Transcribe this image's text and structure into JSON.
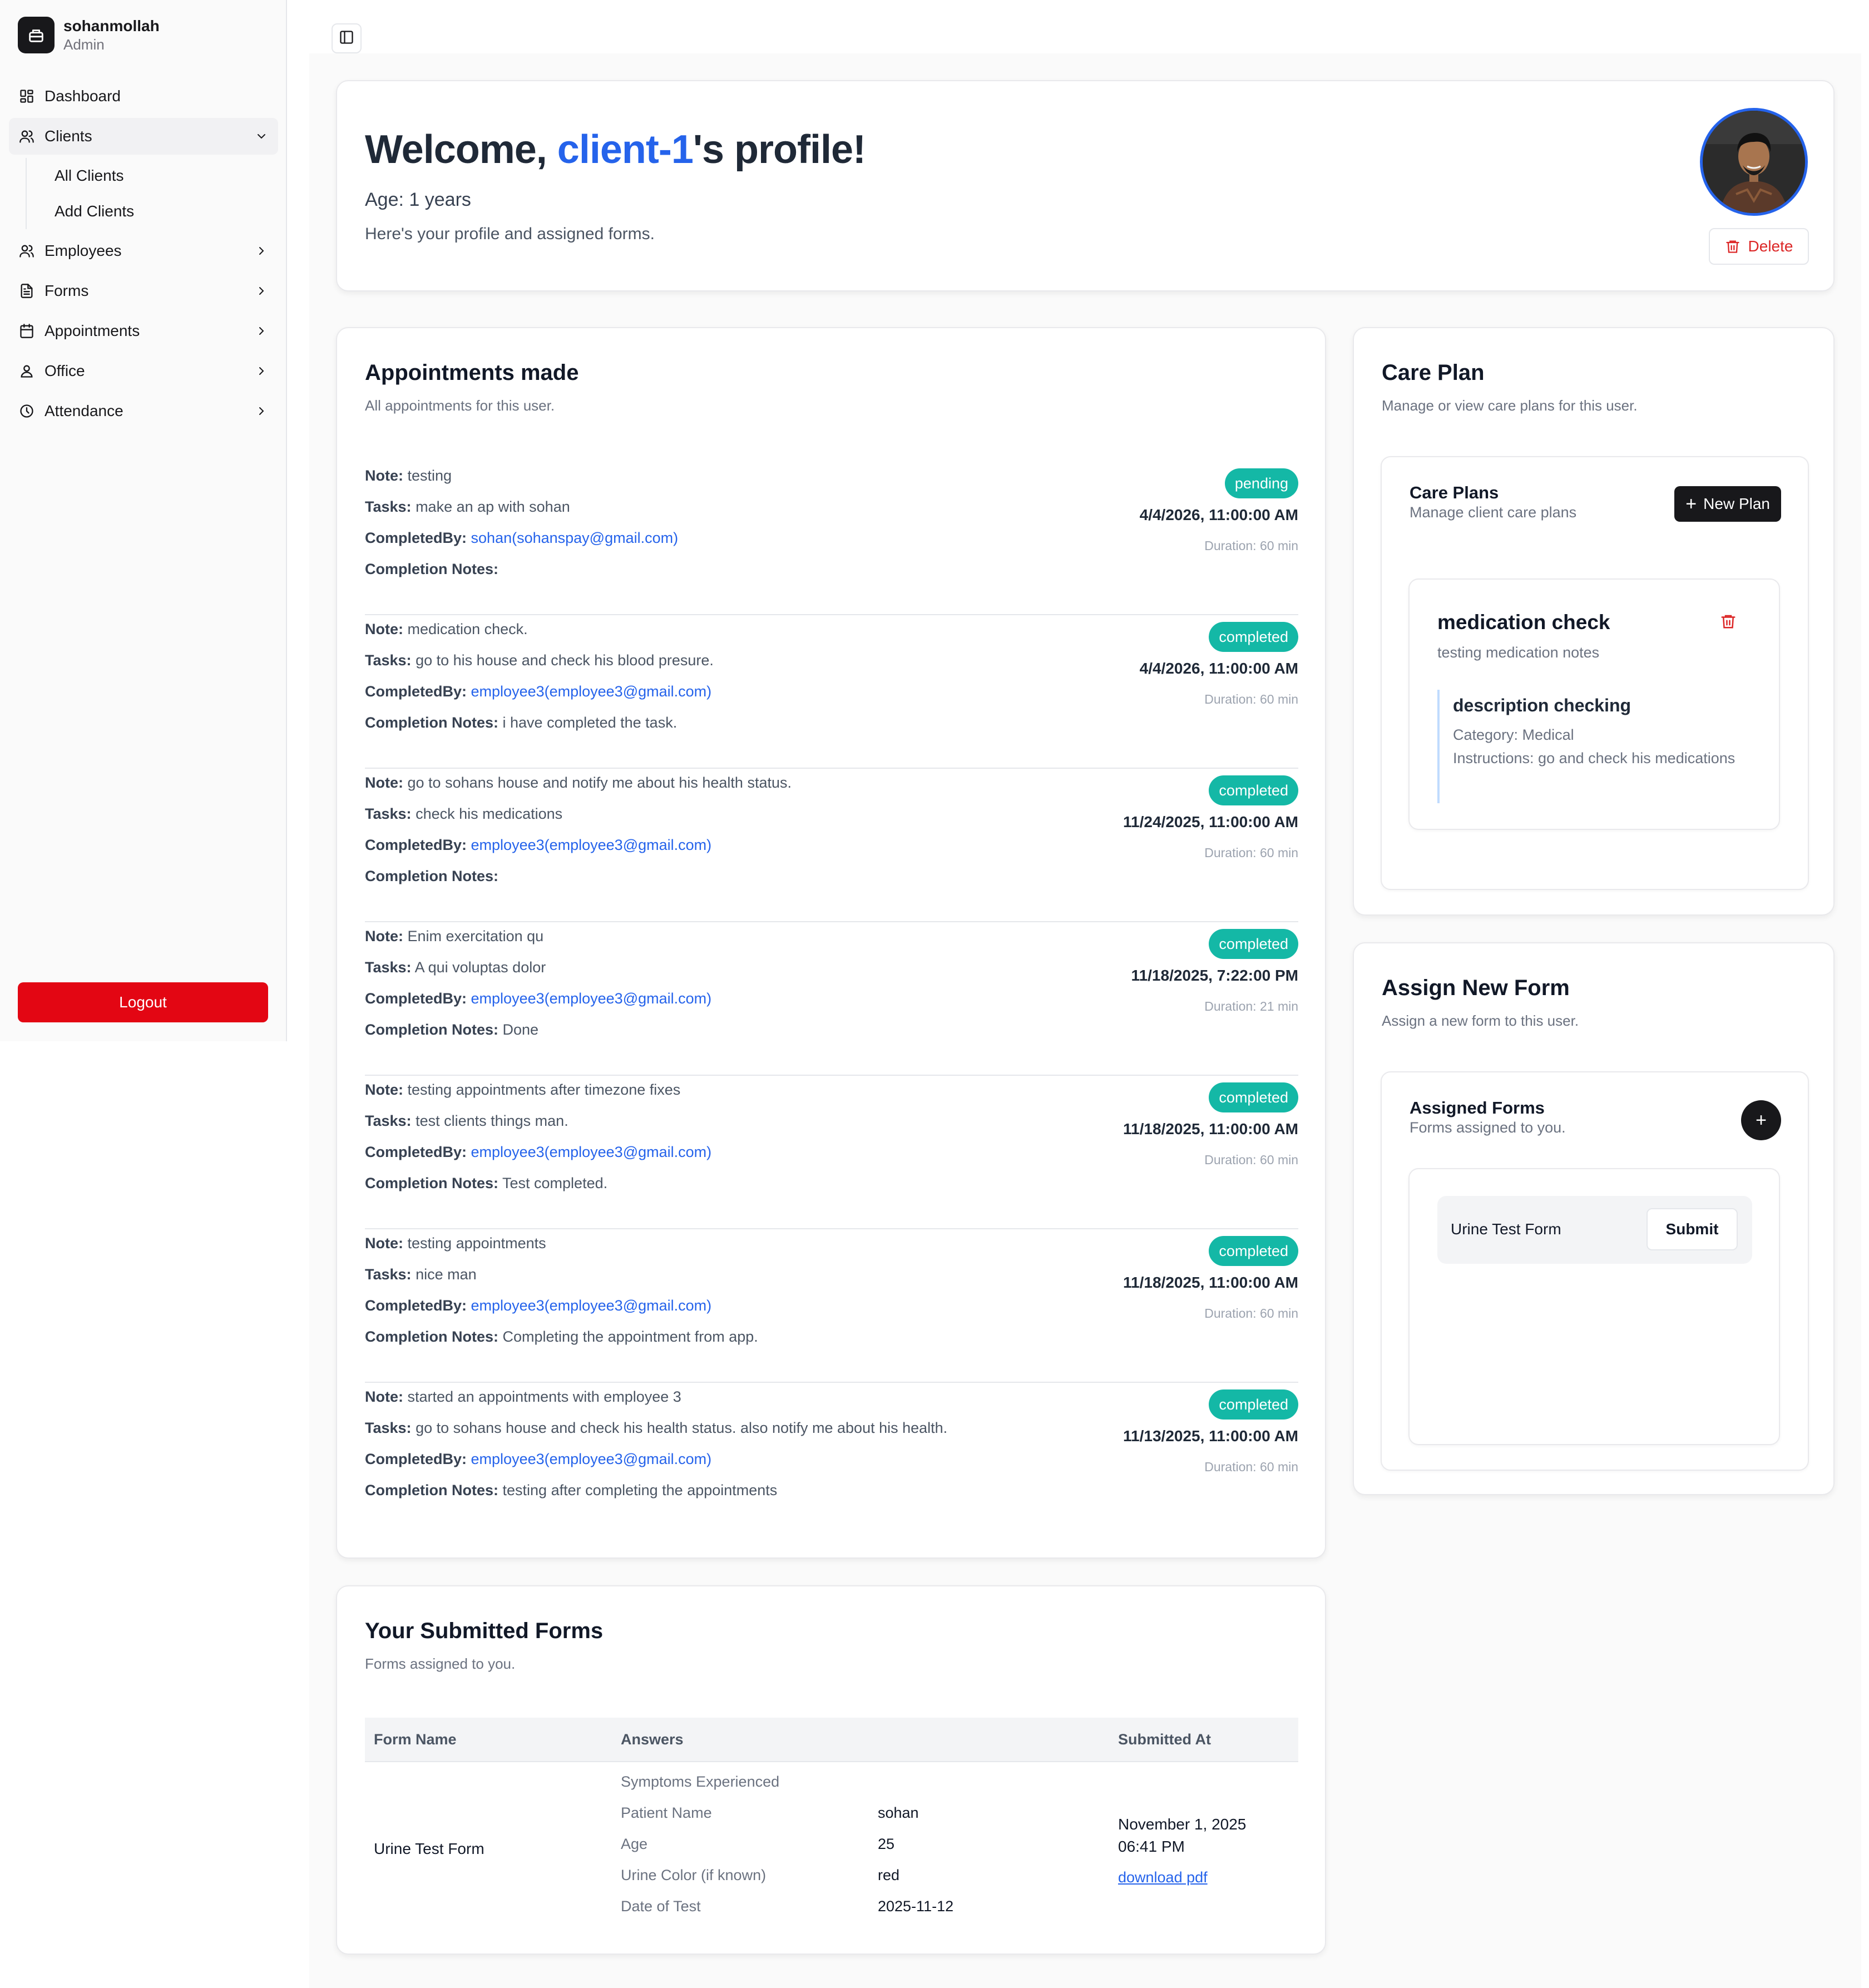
{
  "brand": {
    "name": "sohanmollah",
    "role": "Admin"
  },
  "sidebar": {
    "items": [
      {
        "label": "Dashboard"
      },
      {
        "label": "Clients",
        "children": [
          "All Clients",
          "Add Clients"
        ]
      },
      {
        "label": "Employees"
      },
      {
        "label": "Forms"
      },
      {
        "label": "Appointments"
      },
      {
        "label": "Office"
      },
      {
        "label": "Attendance"
      }
    ],
    "logout_label": "Logout"
  },
  "welcome": {
    "prefix": "Welcome, ",
    "client_name": "client-1",
    "suffix": "'s profile!",
    "age": "Age: 1 years",
    "subtitle": "Here's your profile and assigned forms.",
    "delete_label": "Delete"
  },
  "appointments": {
    "title": "Appointments made",
    "description": "All appointments for this user.",
    "labels": {
      "note": "Note:",
      "tasks": "Tasks:",
      "completed_by": "CompletedBy:",
      "completion_notes": "Completion Notes:"
    },
    "items": [
      {
        "note": "testing",
        "tasks": "make an ap with sohan",
        "completed_by": "sohan(sohanspay@gmail.com)",
        "completion_notes": "",
        "status": "pending",
        "datetime": "4/4/2026, 11:00:00 AM",
        "duration": "Duration: 60 min"
      },
      {
        "note": "medication check.",
        "tasks": "go to his house and check his blood presure.",
        "completed_by": "employee3(employee3@gmail.com)",
        "completion_notes": "i have completed the task.",
        "status": "completed",
        "datetime": "4/4/2026, 11:00:00 AM",
        "duration": "Duration: 60 min"
      },
      {
        "note": "go to sohans house and notify me about his health status.",
        "tasks": "check his medications",
        "completed_by": "employee3(employee3@gmail.com)",
        "completion_notes": "",
        "status": "completed",
        "datetime": "11/24/2025, 11:00:00 AM",
        "duration": "Duration: 60 min"
      },
      {
        "note": "Enim exercitation qu",
        "tasks": "A qui voluptas dolor",
        "completed_by": "employee3(employee3@gmail.com)",
        "completion_notes": "Done",
        "status": "completed",
        "datetime": "11/18/2025, 7:22:00 PM",
        "duration": "Duration: 21 min"
      },
      {
        "note": "testing appointments after timezone fixes",
        "tasks": "test clients things man.",
        "completed_by": "employee3(employee3@gmail.com)",
        "completion_notes": "Test completed.",
        "status": "completed",
        "datetime": "11/18/2025, 11:00:00 AM",
        "duration": "Duration: 60 min"
      },
      {
        "note": "testing appointments",
        "tasks": "nice man",
        "completed_by": "employee3(employee3@gmail.com)",
        "completion_notes": "Completing the appointment from app.",
        "status": "completed",
        "datetime": "11/18/2025, 11:00:00 AM",
        "duration": "Duration: 60 min"
      },
      {
        "note": "started an appointments with employee 3",
        "tasks": "go to sohans house and check his health status. also notify me about his health.",
        "completed_by": "employee3(employee3@gmail.com)",
        "completion_notes": "testing after completing the appointments",
        "status": "completed",
        "datetime": "11/13/2025, 11:00:00 AM",
        "duration": "Duration: 60 min"
      }
    ]
  },
  "submitted_forms": {
    "title": "Your Submitted Forms",
    "description": "Forms assigned to you.",
    "columns": [
      "Form Name",
      "Answers",
      "Submitted At"
    ],
    "rows": [
      {
        "form_name": "Urine Test Form",
        "answers": [
          {
            "q": "Symptoms Experienced",
            "a": ""
          },
          {
            "q": "Patient Name",
            "a": "sohan"
          },
          {
            "q": "Age",
            "a": "25"
          },
          {
            "q": "Urine Color (if known)",
            "a": "red"
          },
          {
            "q": "Date of Test",
            "a": "2025-11-12"
          }
        ],
        "submitted_date": "November 1, 2025",
        "submitted_time": "06:41 PM",
        "download_label": "download pdf"
      }
    ]
  },
  "care_plan": {
    "title": "Care Plan",
    "description": "Manage or view care plans for this user.",
    "inner_title": "Care Plans",
    "inner_desc": "Manage client care plans",
    "new_plan_label": "New Plan",
    "plan": {
      "title": "medication check",
      "notes": "testing medication notes",
      "task_title": "description checking",
      "category": "Category: Medical",
      "instructions": "Instructions: go and check his medications"
    }
  },
  "assign_form": {
    "title": "Assign New Form",
    "description": "Assign a new form to this user.",
    "inner_title": "Assigned Forms",
    "inner_desc": "Forms assigned to you.",
    "plus_label": "+",
    "forms": [
      {
        "name": "Urine Test Form",
        "action": "Submit"
      }
    ]
  },
  "colors": {
    "accent": "#2563eb",
    "status_badge": "#14b8a6",
    "danger": "#e30613",
    "dark": "#18181b"
  },
  "icons": [
    "app-logo-icon",
    "dashboard-icon",
    "users-icon",
    "chevron-down-icon",
    "chevron-right-icon",
    "file-icon",
    "calendar-icon",
    "office-icon",
    "clock-icon",
    "sidebar-toggle-icon",
    "trash-icon",
    "plus-icon"
  ]
}
